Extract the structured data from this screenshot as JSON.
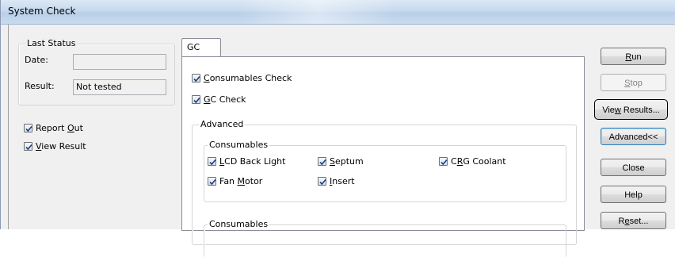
{
  "window": {
    "title": "System Check"
  },
  "last_status": {
    "group_label": "Last Status",
    "date_label": "Date:",
    "date_value": "",
    "result_label": "Result:",
    "result_value": "Not tested"
  },
  "options": {
    "report_out": {
      "label_pre": "Report ",
      "label_key": "O",
      "label_post": "ut",
      "checked": true
    },
    "view_result": {
      "label_pre": "",
      "label_key": "V",
      "label_post": "iew Result",
      "checked": true
    }
  },
  "tab": {
    "label": "GC"
  },
  "checks": {
    "consumables_check": {
      "label_pre": "",
      "label_key": "C",
      "label_post": "onsumables Check",
      "checked": true
    },
    "gc_check": {
      "label_pre": "",
      "label_key": "G",
      "label_post": "C Check",
      "checked": true
    }
  },
  "advanced": {
    "group_label": "Advanced",
    "consumables_group_label": "Consumables",
    "items": [
      {
        "label_pre": "",
        "label_key": "L",
        "label_post": "CD Back Light",
        "checked": true
      },
      {
        "label_pre": "",
        "label_key": "S",
        "label_post": "eptum",
        "checked": true
      },
      {
        "label_pre": "C",
        "label_key": "R",
        "label_post": "G Coolant",
        "checked": true
      },
      {
        "label_pre": "Fan ",
        "label_key": "M",
        "label_post": "otor",
        "checked": true
      },
      {
        "label_pre": "",
        "label_key": "I",
        "label_post": "nsert",
        "checked": true
      }
    ],
    "consumables_group2_label": "Consumables"
  },
  "buttons": {
    "run": {
      "pre": "",
      "key": "R",
      "post": "un"
    },
    "stop": {
      "pre": "",
      "key": "S",
      "post": "top"
    },
    "view_results": {
      "pre": "Vie",
      "key": "w",
      "post": " Results..."
    },
    "advanced": {
      "pre": "Advanced<<",
      "key": "",
      "post": ""
    },
    "close": {
      "pre": "Close",
      "key": "",
      "post": ""
    },
    "help": {
      "pre": "Help",
      "key": "",
      "post": ""
    },
    "reset": {
      "pre": "R",
      "key": "e",
      "post": "set..."
    }
  }
}
